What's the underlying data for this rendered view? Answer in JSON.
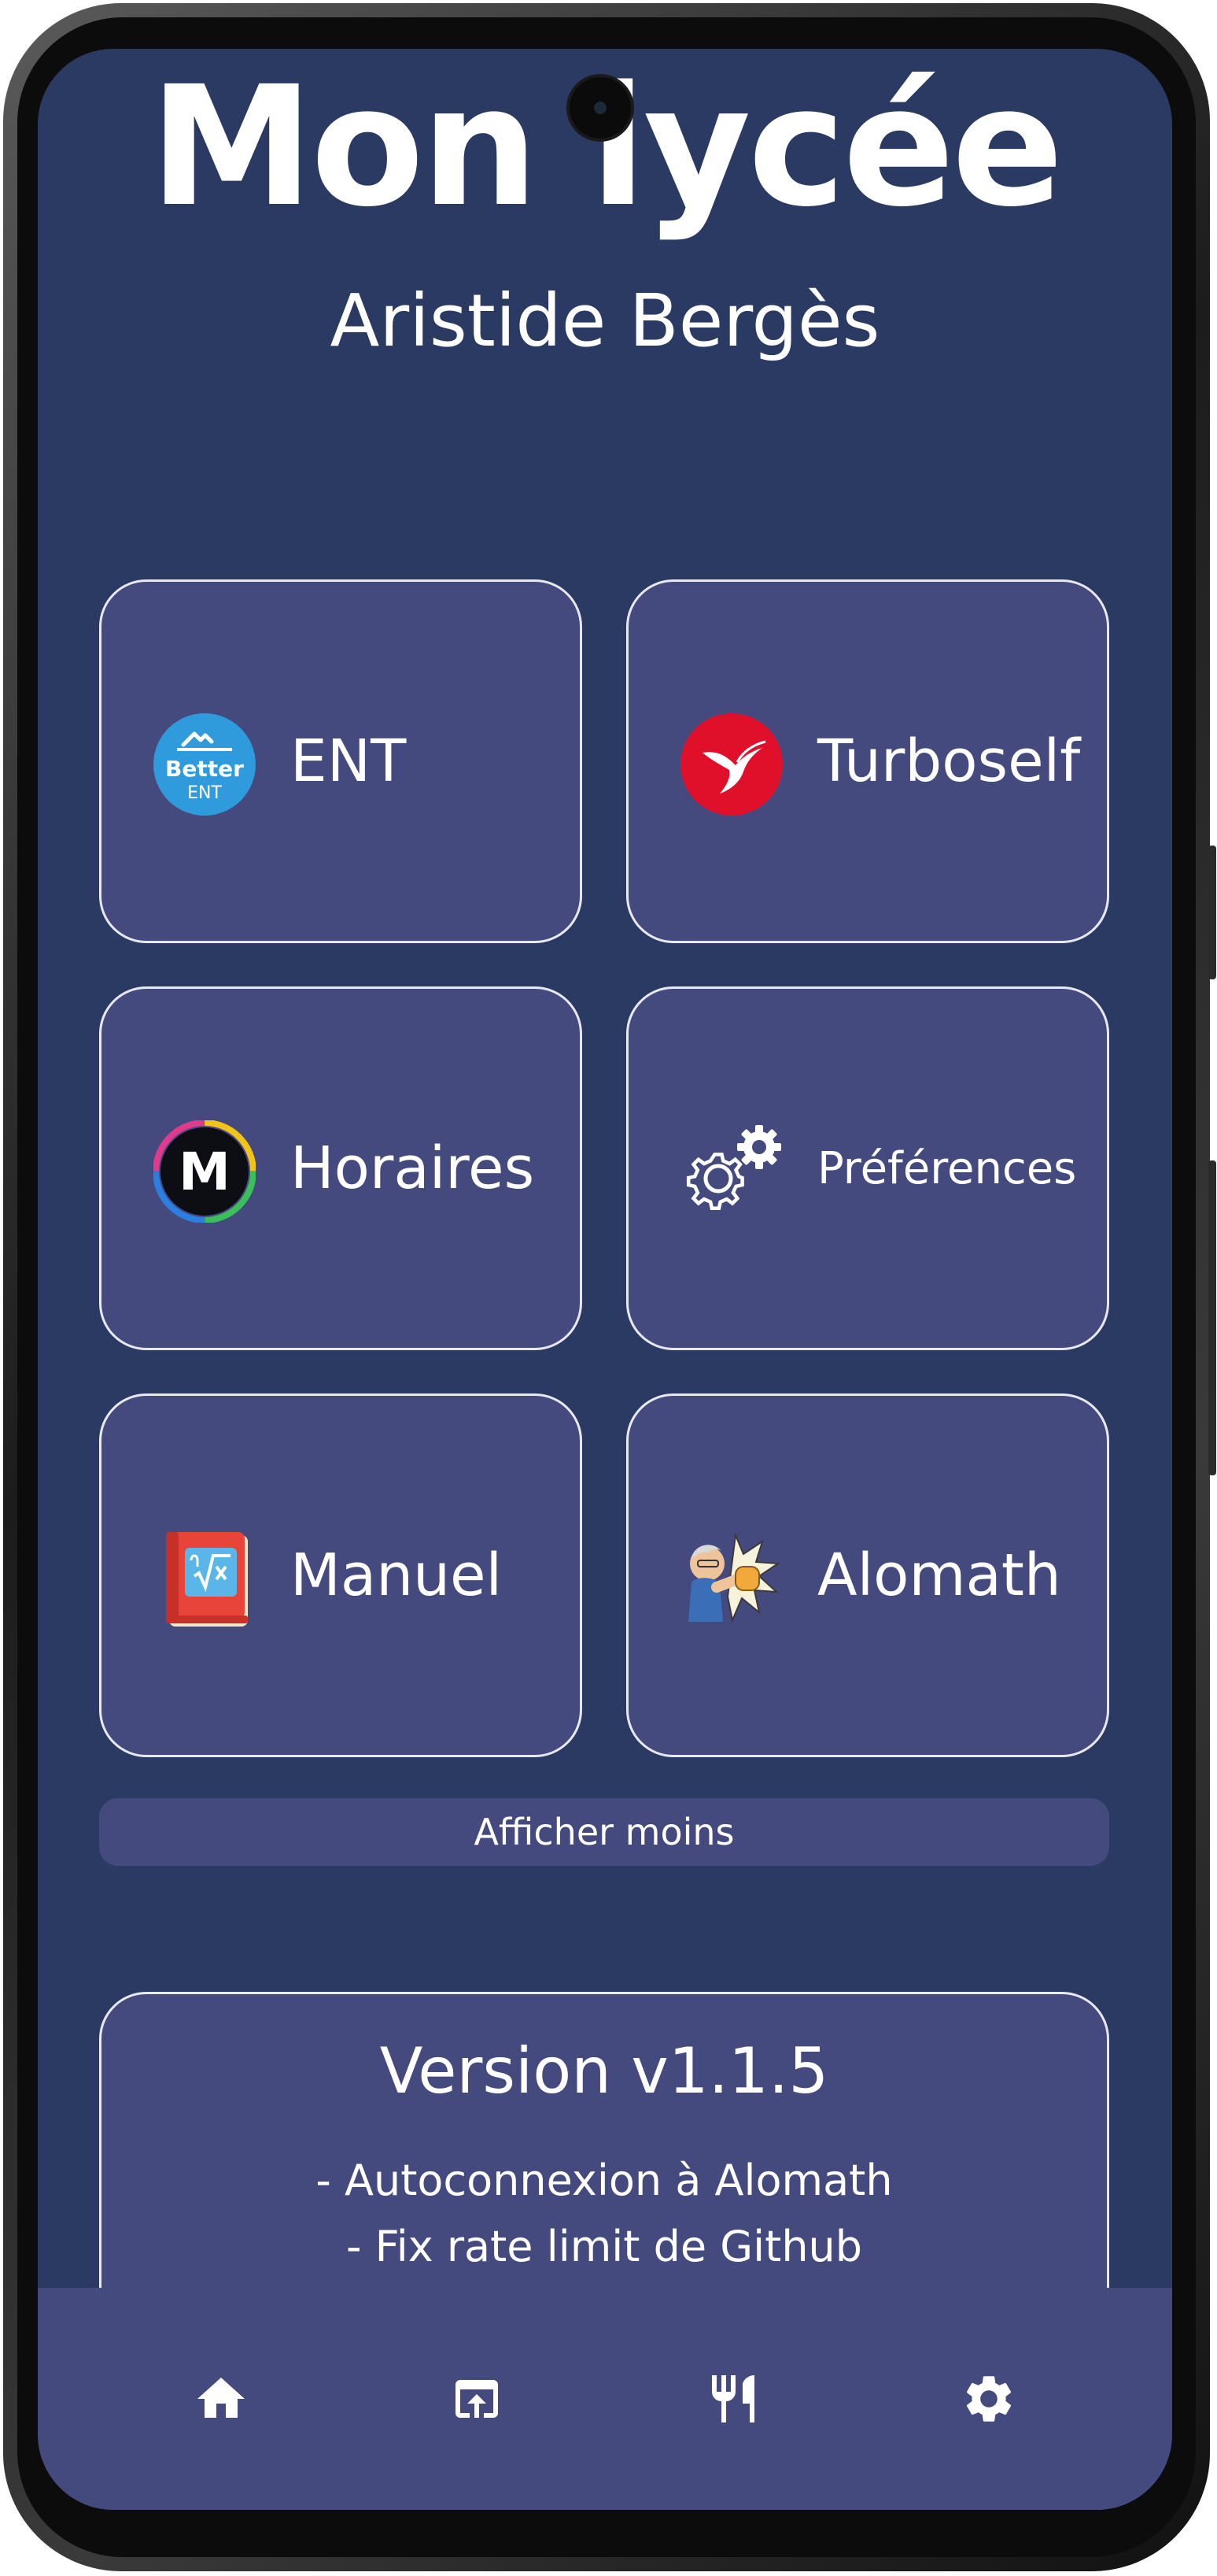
{
  "header": {
    "title": "Mon lycée",
    "subtitle": "Aristide Bergès"
  },
  "cards": [
    {
      "label": "ENT",
      "icon": "better-ent-logo-icon",
      "icon_text_top": "Better",
      "icon_text_bottom": "ENT"
    },
    {
      "label": "Turboself",
      "icon": "hummingbird-logo-icon"
    },
    {
      "label": "Horaires",
      "icon": "m-logo-icon",
      "icon_text": "M"
    },
    {
      "label": "Préférences",
      "icon": "gears-icon"
    },
    {
      "label": "Manuel",
      "icon": "math-book-icon"
    },
    {
      "label": "Alomath",
      "icon": "punch-avatar-icon"
    }
  ],
  "toggle_button": "Afficher moins",
  "version_card": {
    "title": "Version v1.1.5",
    "changes": [
      "- Autoconnexion à Alomath",
      "- Fix rate limit de Github"
    ]
  },
  "bottom_nav": [
    {
      "icon": "home-icon"
    },
    {
      "icon": "open-in-browser-icon"
    },
    {
      "icon": "restaurant-icon"
    },
    {
      "icon": "settings-gear-icon"
    }
  ],
  "colors": {
    "background": "#2b3a62",
    "card": "#454a7e",
    "text": "#ffffff"
  }
}
